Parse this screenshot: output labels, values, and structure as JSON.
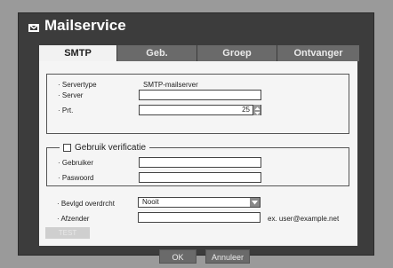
{
  "window": {
    "title": "Mailservice"
  },
  "tabs": [
    {
      "label": "SMTP",
      "active": true
    },
    {
      "label": "Geb.",
      "active": false
    },
    {
      "label": "Groep",
      "active": false
    },
    {
      "label": "Ontvanger",
      "active": false
    }
  ],
  "server_group": {
    "servertype_label": "· Servertype",
    "servertype_value": "SMTP-mailserver",
    "server_label": "· Server",
    "server_value": "",
    "port_label": "· Prt.",
    "port_value": "25"
  },
  "auth_group": {
    "checkbox_label": "Gebruik verificatie",
    "checked": false,
    "user_label": "· Gebruiker",
    "user_value": "",
    "password_label": "· Paswoord",
    "password_value": ""
  },
  "security": {
    "label": "· Bevlgd overdrcht",
    "value": "Nooit"
  },
  "sender": {
    "label": "· Afzender",
    "value": "",
    "hint": "ex. user@example.net"
  },
  "buttons": {
    "test": "TEST",
    "ok": "OK",
    "cancel": "Annuleer"
  },
  "icons": {
    "title_icon": "envelope-icon",
    "port_stepper": "up-down-arrows-icon",
    "dropdown": "chevron-down-icon"
  },
  "colors": {
    "window_bg": "#3c3c3c",
    "panel_bg": "#f5f5f5",
    "tab_inactive": "#6a6a6a",
    "tab_active": "#f2f2f2"
  }
}
